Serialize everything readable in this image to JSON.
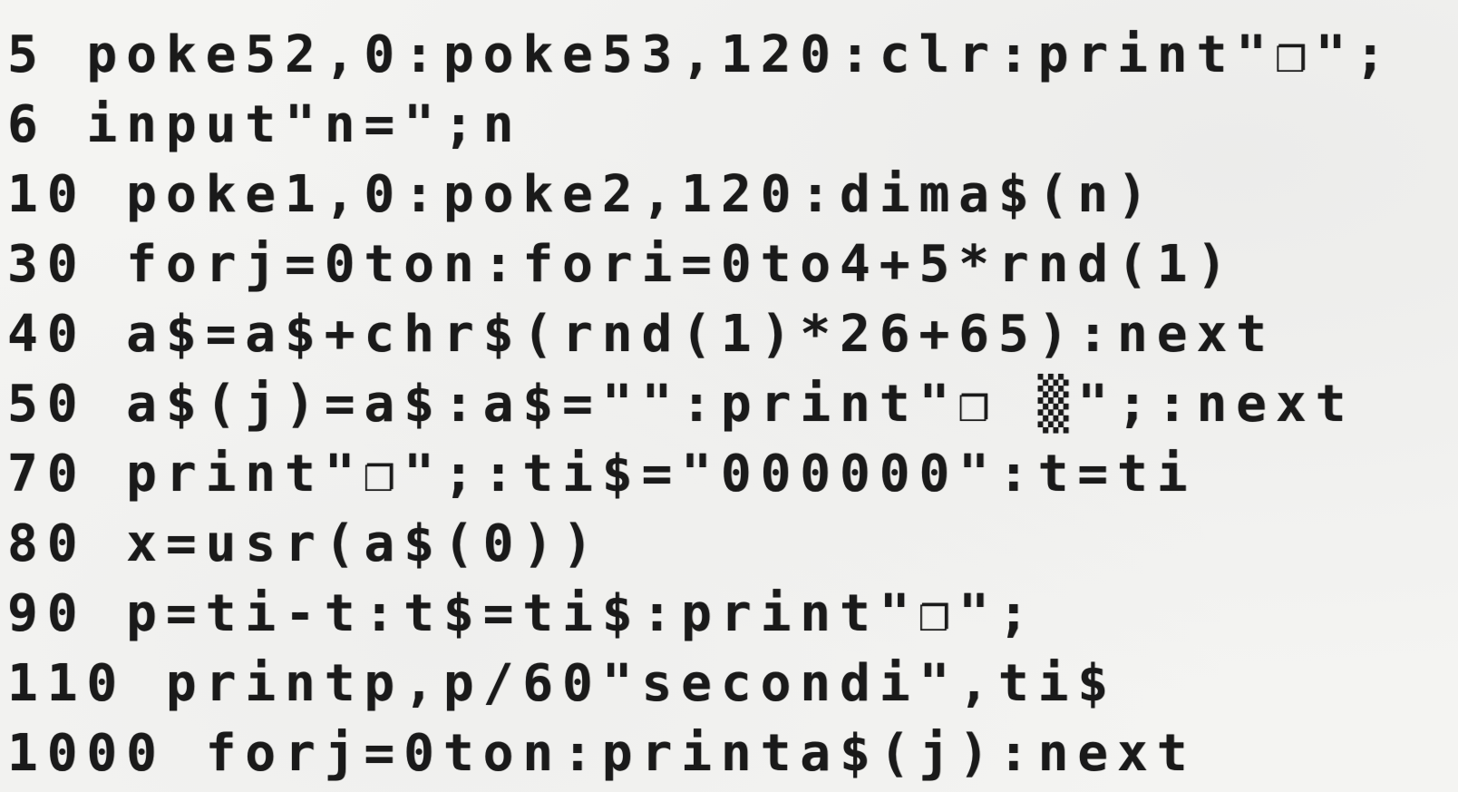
{
  "listing": {
    "lines": [
      "5 poke52,0:poke53,120:clr:print\"❐\";",
      "6 input\"n=\";n",
      "10 poke1,0:poke2,120:dima$(n)",
      "30 forj=0ton:fori=0to4+5*rnd(1)",
      "40 a$=a$+chr$(rnd(1)*26+65):next",
      "50 a$(j)=a$:a$=\"\":print\"❐ ▒\";:next",
      "70 print\"❐\";:ti$=\"000000\":t=ti",
      "80 x=usr(a$(0))",
      "90 p=ti-t:t$=ti$:print\"❐\";",
      "110 printp,p/60\"secondi\",ti$",
      "1000 forj=0ton:printa$(j):next"
    ]
  }
}
